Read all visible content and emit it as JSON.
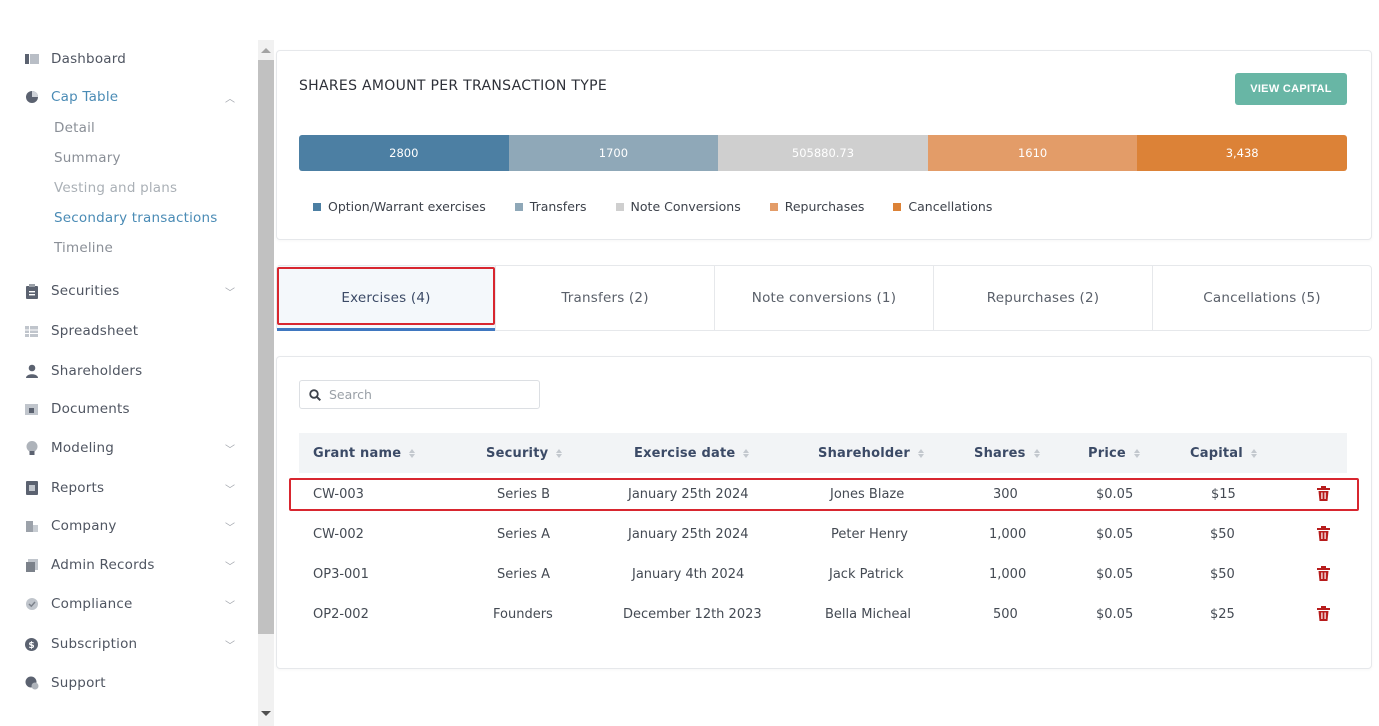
{
  "sidebar": {
    "items": [
      {
        "label": "Dashboard",
        "icon": "dashboard-icon"
      },
      {
        "label": "Cap Table",
        "icon": "pie-chart-icon"
      },
      {
        "label": "Securities",
        "icon": "clipboard-icon"
      },
      {
        "label": "Spreadsheet",
        "icon": "table-icon"
      },
      {
        "label": "Shareholders",
        "icon": "person-icon"
      },
      {
        "label": "Documents",
        "icon": "folder-icon"
      },
      {
        "label": "Modeling",
        "icon": "lightbulb-icon"
      },
      {
        "label": "Reports",
        "icon": "report-icon"
      },
      {
        "label": "Company",
        "icon": "building-icon"
      },
      {
        "label": "Admin Records",
        "icon": "records-icon"
      },
      {
        "label": "Compliance",
        "icon": "check-shield-icon"
      },
      {
        "label": "Subscription",
        "icon": "dollar-icon"
      },
      {
        "label": "Support",
        "icon": "support-icon"
      }
    ],
    "cap_table_sub": [
      "Detail",
      "Summary",
      "Vesting and plans",
      "Secondary transactions",
      "Timeline"
    ]
  },
  "summary": {
    "title": "SHARES AMOUNT PER TRANSACTION TYPE",
    "view_button": "VIEW CAPITAL",
    "segments": [
      {
        "label": "2800",
        "color": "#4c7fa3"
      },
      {
        "label": "1700",
        "color": "#8fa8b8"
      },
      {
        "label": "505880.73",
        "color": "#cfcfcf"
      },
      {
        "label": "1610",
        "color": "#e39c68"
      },
      {
        "label": "3,438",
        "color": "#dc8237"
      }
    ],
    "legend": [
      {
        "label": "Option/Warrant exercises",
        "color": "#4c7fa3"
      },
      {
        "label": "Transfers",
        "color": "#8fa8b8"
      },
      {
        "label": "Note Conversions",
        "color": "#cfcfcf"
      },
      {
        "label": "Repurchases",
        "color": "#e39c68"
      },
      {
        "label": "Cancellations",
        "color": "#dc8237"
      }
    ]
  },
  "tabs": [
    "Exercises (4)",
    "Transfers (2)",
    "Note conversions (1)",
    "Repurchases (2)",
    "Cancellations (5)"
  ],
  "search": {
    "placeholder": "Search"
  },
  "table": {
    "headers": [
      "Grant name",
      "Security",
      "Exercise date",
      "Shareholder",
      "Shares",
      "Price",
      "Capital"
    ],
    "rows": [
      [
        "CW-003",
        "Series B",
        "January 25th 2024",
        "Jones Blaze",
        "300",
        "$0.05",
        "$15"
      ],
      [
        "CW-002",
        "Series A",
        "January 25th 2024",
        "Peter Henry",
        "1,000",
        "$0.05",
        "$50"
      ],
      [
        "OP3-001",
        "Series A",
        "January 4th 2024",
        "Jack Patrick",
        "1,000",
        "$0.05",
        "$50"
      ],
      [
        "OP2-002",
        "Founders",
        "December 12th 2023",
        "Bella Micheal",
        "500",
        "$0.05",
        "$25"
      ]
    ]
  }
}
